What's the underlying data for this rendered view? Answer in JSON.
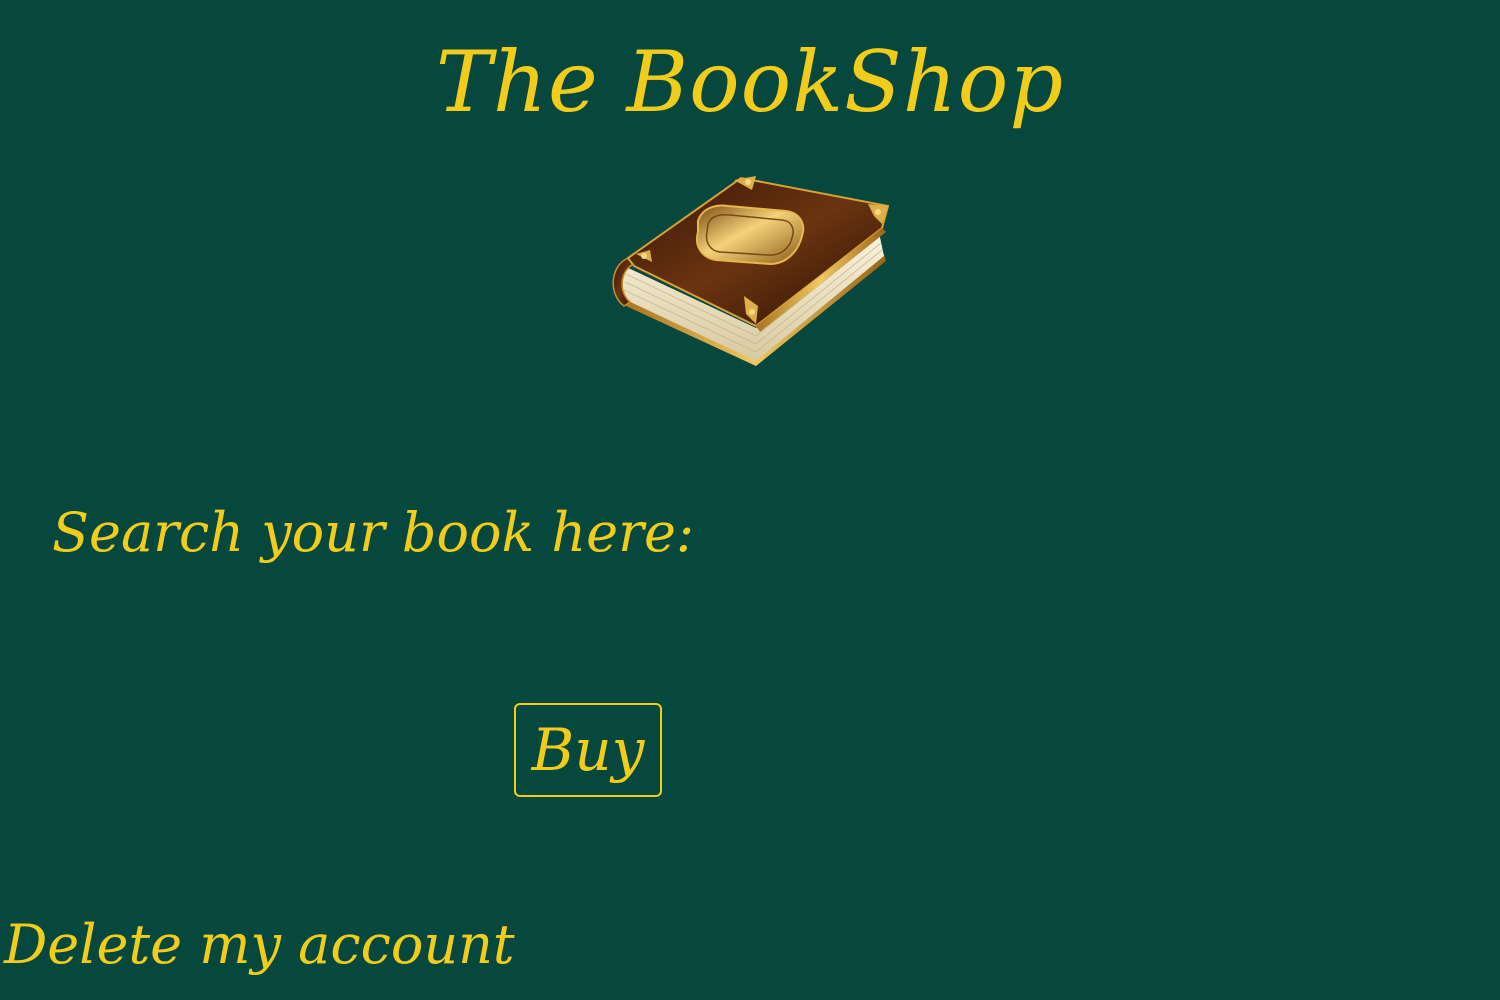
{
  "header": {
    "title": "The BookShop",
    "logo_icon": "book-icon"
  },
  "search": {
    "label": "Search your book here:"
  },
  "actions": {
    "buy_label": "Buy",
    "delete_account_label": "Delete my account"
  },
  "colors": {
    "background": "#06483D",
    "text": "#F2CC1B",
    "book_cover": "#5A2A0E",
    "book_trim": "#D9A334",
    "book_pages": "#F3EAD0"
  }
}
